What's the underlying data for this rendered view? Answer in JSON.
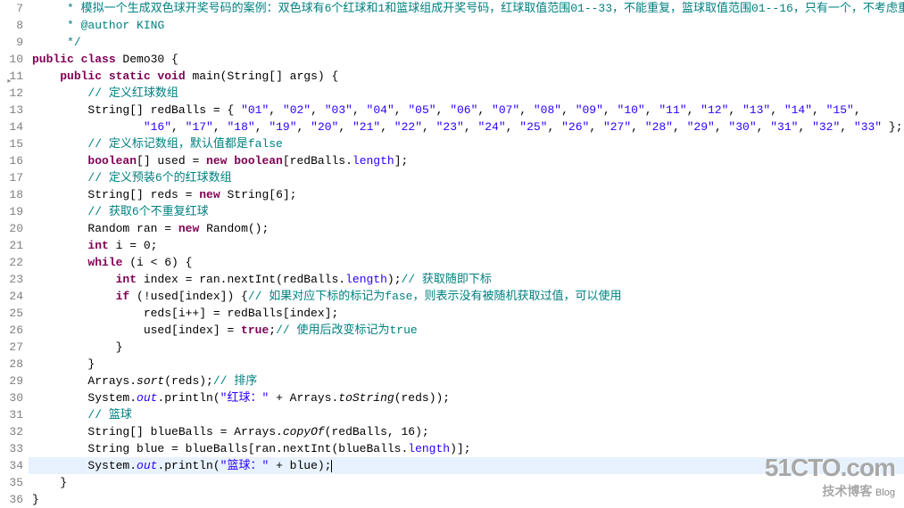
{
  "lines": [
    {
      "num": "7",
      "indent": 1,
      "segments": [
        {
          "t": " * 模拟一个生成双色球开奖号码的案例：双色球有6个红球和1和篮球组成开奖号码，红球取值范围01--33，不能重复，篮球取值范围01--16，只有一个，不考虑重复。",
          "cls": "c-comment"
        }
      ]
    },
    {
      "num": "8",
      "indent": 1,
      "segments": [
        {
          "t": " * ",
          "cls": "c-comment"
        },
        {
          "t": "@author",
          "cls": "c-comment"
        },
        {
          "t": " KING",
          "cls": "c-comment"
        }
      ]
    },
    {
      "num": "9",
      "indent": 1,
      "segments": [
        {
          "t": " */",
          "cls": "c-comment"
        }
      ]
    },
    {
      "num": "10",
      "indent": 0,
      "segments": [
        {
          "t": "public class ",
          "cls": "c-keyword"
        },
        {
          "t": "Demo30 {",
          "cls": ""
        }
      ]
    },
    {
      "num": "11",
      "arrow": true,
      "indent": 1,
      "segments": [
        {
          "t": "public static void ",
          "cls": "c-keyword"
        },
        {
          "t": "main(String[] args) {",
          "cls": ""
        }
      ]
    },
    {
      "num": "12",
      "indent": 2,
      "segments": [
        {
          "t": "// 定义红球数组",
          "cls": "c-comment"
        }
      ]
    },
    {
      "num": "13",
      "indent": 2,
      "segments": [
        {
          "t": "String[] redBalls = { ",
          "cls": ""
        },
        {
          "t": "\"01\"",
          "cls": "c-string"
        },
        {
          "t": ", ",
          "cls": ""
        },
        {
          "t": "\"02\"",
          "cls": "c-string"
        },
        {
          "t": ", ",
          "cls": ""
        },
        {
          "t": "\"03\"",
          "cls": "c-string"
        },
        {
          "t": ", ",
          "cls": ""
        },
        {
          "t": "\"04\"",
          "cls": "c-string"
        },
        {
          "t": ", ",
          "cls": ""
        },
        {
          "t": "\"05\"",
          "cls": "c-string"
        },
        {
          "t": ", ",
          "cls": ""
        },
        {
          "t": "\"06\"",
          "cls": "c-string"
        },
        {
          "t": ", ",
          "cls": ""
        },
        {
          "t": "\"07\"",
          "cls": "c-string"
        },
        {
          "t": ", ",
          "cls": ""
        },
        {
          "t": "\"08\"",
          "cls": "c-string"
        },
        {
          "t": ", ",
          "cls": ""
        },
        {
          "t": "\"09\"",
          "cls": "c-string"
        },
        {
          "t": ", ",
          "cls": ""
        },
        {
          "t": "\"10\"",
          "cls": "c-string"
        },
        {
          "t": ", ",
          "cls": ""
        },
        {
          "t": "\"11\"",
          "cls": "c-string"
        },
        {
          "t": ", ",
          "cls": ""
        },
        {
          "t": "\"12\"",
          "cls": "c-string"
        },
        {
          "t": ", ",
          "cls": ""
        },
        {
          "t": "\"13\"",
          "cls": "c-string"
        },
        {
          "t": ", ",
          "cls": ""
        },
        {
          "t": "\"14\"",
          "cls": "c-string"
        },
        {
          "t": ", ",
          "cls": ""
        },
        {
          "t": "\"15\"",
          "cls": "c-string"
        },
        {
          "t": ",",
          "cls": ""
        }
      ]
    },
    {
      "num": "14",
      "indent": 4,
      "segments": [
        {
          "t": "\"16\"",
          "cls": "c-string"
        },
        {
          "t": ", ",
          "cls": ""
        },
        {
          "t": "\"17\"",
          "cls": "c-string"
        },
        {
          "t": ", ",
          "cls": ""
        },
        {
          "t": "\"18\"",
          "cls": "c-string"
        },
        {
          "t": ", ",
          "cls": ""
        },
        {
          "t": "\"19\"",
          "cls": "c-string"
        },
        {
          "t": ", ",
          "cls": ""
        },
        {
          "t": "\"20\"",
          "cls": "c-string"
        },
        {
          "t": ", ",
          "cls": ""
        },
        {
          "t": "\"21\"",
          "cls": "c-string"
        },
        {
          "t": ", ",
          "cls": ""
        },
        {
          "t": "\"22\"",
          "cls": "c-string"
        },
        {
          "t": ", ",
          "cls": ""
        },
        {
          "t": "\"23\"",
          "cls": "c-string"
        },
        {
          "t": ", ",
          "cls": ""
        },
        {
          "t": "\"24\"",
          "cls": "c-string"
        },
        {
          "t": ", ",
          "cls": ""
        },
        {
          "t": "\"25\"",
          "cls": "c-string"
        },
        {
          "t": ", ",
          "cls": ""
        },
        {
          "t": "\"26\"",
          "cls": "c-string"
        },
        {
          "t": ", ",
          "cls": ""
        },
        {
          "t": "\"27\"",
          "cls": "c-string"
        },
        {
          "t": ", ",
          "cls": ""
        },
        {
          "t": "\"28\"",
          "cls": "c-string"
        },
        {
          "t": ", ",
          "cls": ""
        },
        {
          "t": "\"29\"",
          "cls": "c-string"
        },
        {
          "t": ", ",
          "cls": ""
        },
        {
          "t": "\"30\"",
          "cls": "c-string"
        },
        {
          "t": ", ",
          "cls": ""
        },
        {
          "t": "\"31\"",
          "cls": "c-string"
        },
        {
          "t": ", ",
          "cls": ""
        },
        {
          "t": "\"32\"",
          "cls": "c-string"
        },
        {
          "t": ", ",
          "cls": ""
        },
        {
          "t": "\"33\"",
          "cls": "c-string"
        },
        {
          "t": " };",
          "cls": ""
        }
      ]
    },
    {
      "num": "15",
      "indent": 2,
      "segments": [
        {
          "t": "// 定义标记数组，默认值都是false",
          "cls": "c-comment"
        }
      ]
    },
    {
      "num": "16",
      "indent": 2,
      "segments": [
        {
          "t": "boolean",
          "cls": "c-keyword"
        },
        {
          "t": "[] used = ",
          "cls": ""
        },
        {
          "t": "new boolean",
          "cls": "c-keyword"
        },
        {
          "t": "[redBalls.",
          "cls": ""
        },
        {
          "t": "length",
          "cls": "c-string"
        },
        {
          "t": "];",
          "cls": ""
        }
      ]
    },
    {
      "num": "17",
      "indent": 2,
      "segments": [
        {
          "t": "// 定义预装6个的红球数组",
          "cls": "c-comment"
        }
      ]
    },
    {
      "num": "18",
      "indent": 2,
      "segments": [
        {
          "t": "String[] reds = ",
          "cls": ""
        },
        {
          "t": "new ",
          "cls": "c-keyword"
        },
        {
          "t": "String[6];",
          "cls": ""
        }
      ]
    },
    {
      "num": "19",
      "indent": 2,
      "segments": [
        {
          "t": "// 获取6个不重复红球",
          "cls": "c-comment"
        }
      ]
    },
    {
      "num": "20",
      "indent": 2,
      "segments": [
        {
          "t": "Random ran = ",
          "cls": ""
        },
        {
          "t": "new ",
          "cls": "c-keyword"
        },
        {
          "t": "Random();",
          "cls": ""
        }
      ]
    },
    {
      "num": "21",
      "indent": 2,
      "segments": [
        {
          "t": "int ",
          "cls": "c-keyword"
        },
        {
          "t": "i = 0;",
          "cls": ""
        }
      ]
    },
    {
      "num": "22",
      "indent": 2,
      "segments": [
        {
          "t": "while ",
          "cls": "c-keyword"
        },
        {
          "t": "(i < 6) {",
          "cls": ""
        }
      ]
    },
    {
      "num": "23",
      "indent": 3,
      "segments": [
        {
          "t": "int ",
          "cls": "c-keyword"
        },
        {
          "t": "index = ran.nextInt(redBalls.",
          "cls": ""
        },
        {
          "t": "length",
          "cls": "c-string"
        },
        {
          "t": ");",
          "cls": ""
        },
        {
          "t": "// 获取随即下标",
          "cls": "c-comment"
        }
      ]
    },
    {
      "num": "24",
      "indent": 3,
      "segments": [
        {
          "t": "if ",
          "cls": "c-keyword"
        },
        {
          "t": "(!used[index]) {",
          "cls": ""
        },
        {
          "t": "// 如果对应下标的标记为fase，则表示没有被随机获取过值，可以使用",
          "cls": "c-comment"
        }
      ]
    },
    {
      "num": "25",
      "indent": 4,
      "segments": [
        {
          "t": "reds[i++] = redBalls[index];",
          "cls": ""
        }
      ]
    },
    {
      "num": "26",
      "indent": 4,
      "segments": [
        {
          "t": "used[index] = ",
          "cls": ""
        },
        {
          "t": "true",
          "cls": "c-keyword"
        },
        {
          "t": ";",
          "cls": ""
        },
        {
          "t": "// 使用后改变标记为true",
          "cls": "c-comment"
        }
      ]
    },
    {
      "num": "27",
      "indent": 3,
      "segments": [
        {
          "t": "}",
          "cls": ""
        }
      ]
    },
    {
      "num": "28",
      "indent": 2,
      "segments": [
        {
          "t": "}",
          "cls": ""
        }
      ]
    },
    {
      "num": "29",
      "indent": 2,
      "segments": [
        {
          "t": "Arrays.",
          "cls": ""
        },
        {
          "t": "sort",
          "cls": "c-method"
        },
        {
          "t": "(reds);",
          "cls": ""
        },
        {
          "t": "// 排序",
          "cls": "c-comment"
        }
      ]
    },
    {
      "num": "30",
      "indent": 2,
      "segments": [
        {
          "t": "System.",
          "cls": ""
        },
        {
          "t": "out",
          "cls": "c-string c-static"
        },
        {
          "t": ".println(",
          "cls": ""
        },
        {
          "t": "\"红球：\"",
          "cls": "c-string"
        },
        {
          "t": " + Arrays.",
          "cls": ""
        },
        {
          "t": "toString",
          "cls": "c-method"
        },
        {
          "t": "(reds));",
          "cls": ""
        }
      ]
    },
    {
      "num": "31",
      "indent": 2,
      "segments": [
        {
          "t": "// 篮球",
          "cls": "c-comment"
        }
      ]
    },
    {
      "num": "32",
      "indent": 2,
      "segments": [
        {
          "t": "String[] blueBalls = Arrays.",
          "cls": ""
        },
        {
          "t": "copyOf",
          "cls": "c-method"
        },
        {
          "t": "(redBalls, 16);",
          "cls": ""
        }
      ]
    },
    {
      "num": "33",
      "indent": 2,
      "segments": [
        {
          "t": "String blue = blueBalls[ran.nextInt(blueBalls.",
          "cls": ""
        },
        {
          "t": "length",
          "cls": "c-string"
        },
        {
          "t": ")];",
          "cls": ""
        }
      ]
    },
    {
      "num": "34",
      "indent": 2,
      "current": true,
      "segments": [
        {
          "t": "System.",
          "cls": ""
        },
        {
          "t": "out",
          "cls": "c-string c-static"
        },
        {
          "t": ".println(",
          "cls": ""
        },
        {
          "t": "\"篮球：\"",
          "cls": "c-string"
        },
        {
          "t": " + blue);",
          "cls": ""
        }
      ],
      "cursor": true
    },
    {
      "num": "35",
      "indent": 1,
      "segments": [
        {
          "t": "}",
          "cls": ""
        }
      ]
    },
    {
      "num": "36",
      "indent": 0,
      "segments": [
        {
          "t": "}",
          "cls": ""
        }
      ]
    }
  ],
  "watermark": {
    "big": "51CTO.com",
    "small": "技术博客",
    "blog": "Blog"
  }
}
